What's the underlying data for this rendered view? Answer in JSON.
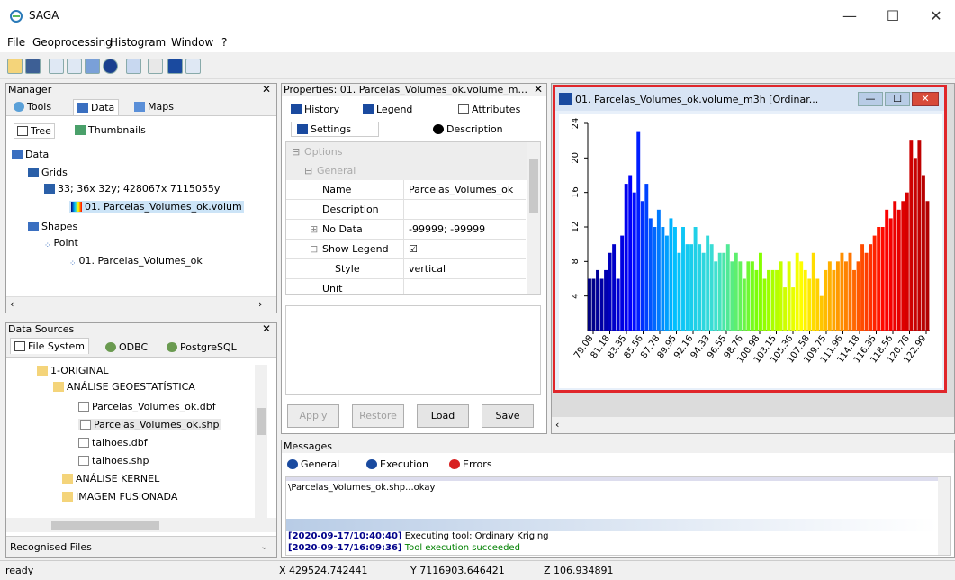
{
  "window": {
    "title": "SAGA",
    "minimize": "—",
    "maximize": "☐",
    "close": "✕"
  },
  "menu": [
    "File",
    "Geoprocessing",
    "Histogram",
    "Window",
    "?"
  ],
  "manager": {
    "title": "Manager",
    "tabs": [
      "Tools",
      "Data",
      "Maps"
    ],
    "subtabs": [
      "Tree",
      "Thumbnails"
    ],
    "tree": [
      "Data",
      "Grids",
      "33; 36x 32y; 428067x 7115055y",
      "01. Parcelas_Volumes_ok.volum",
      "Shapes",
      "Point",
      "01. Parcelas_Volumes_ok"
    ]
  },
  "datasources": {
    "title": "Data Sources",
    "tabs": [
      "File System",
      "ODBC",
      "PostgreSQL"
    ],
    "tree": [
      "1-ORIGINAL",
      "ANÁLISE GEOESTATÍSTICA",
      "Parcelas_Volumes_ok.dbf",
      "Parcelas_Volumes_ok.shp",
      "talhoes.dbf",
      "talhoes.shp",
      "ANÁLISE KERNEL",
      "IMAGEM FUSIONADA"
    ],
    "filter": "Recognised Files"
  },
  "properties": {
    "title": "Properties: 01. Parcelas_Volumes_ok.volume_m...",
    "tabs": [
      "History",
      "Legend",
      "Attributes",
      "Settings",
      "Description"
    ],
    "options_label": "Options",
    "general_label": "General",
    "rows": [
      {
        "key": "Name",
        "value": "Parcelas_Volumes_ok"
      },
      {
        "key": "Description",
        "value": ""
      },
      {
        "key": "No Data",
        "value": "-99999; -99999"
      },
      {
        "key": "Show Legend",
        "value": "☑"
      },
      {
        "key": "Style",
        "value": "vertical"
      },
      {
        "key": "Unit",
        "value": ""
      }
    ],
    "buttons": {
      "apply": "Apply",
      "restore": "Restore",
      "load": "Load",
      "save": "Save"
    }
  },
  "histogram_window": {
    "title": "01. Parcelas_Volumes_ok.volume_m3h [Ordinar...",
    "minimize": "—",
    "maximize": "☐",
    "close": "✕"
  },
  "chart_data": {
    "type": "bar",
    "ylim": [
      0,
      24
    ],
    "yticks": [
      "24",
      "20",
      "16",
      "12",
      "8",
      "4"
    ],
    "xticks": [
      "79.08",
      "81.18",
      "83.35",
      "85.56",
      "87.78",
      "89.95",
      "92.16",
      "94.33",
      "96.55",
      "98.76",
      "100.98",
      "103.15",
      "105.36",
      "107.58",
      "109.75",
      "111.96",
      "114.18",
      "116.35",
      "118.56",
      "120.78",
      "122.99"
    ],
    "values": [
      6,
      6,
      7,
      6,
      7,
      9,
      10,
      6,
      11,
      17,
      18,
      16,
      23,
      15,
      17,
      13,
      12,
      14,
      12,
      11,
      13,
      12,
      9,
      12,
      10,
      10,
      12,
      10,
      9,
      11,
      10,
      8,
      9,
      9,
      10,
      8,
      9,
      8,
      6,
      8,
      8,
      7,
      9,
      6,
      7,
      7,
      7,
      8,
      5,
      8,
      5,
      9,
      8,
      7,
      6,
      9,
      6,
      4,
      7,
      8,
      7,
      8,
      9,
      8,
      9,
      7,
      8,
      10,
      9,
      10,
      11,
      12,
      12,
      14,
      13,
      15,
      14,
      15,
      16,
      22,
      20,
      22,
      18,
      15
    ],
    "gradient": [
      "#00007f",
      "#0000ff",
      "#00bfff",
      "#40e0d0",
      "#7fff00",
      "#ffff00",
      "#ff8c00",
      "#ff0000",
      "#b00000"
    ]
  },
  "messages": {
    "title": "Messages",
    "tabs": [
      "General",
      "Execution",
      "Errors"
    ],
    "lines": [
      {
        "ts": "",
        "text": "\\Parcelas_Volumes_ok.shp...okay"
      },
      {
        "ts": "[2020-09-17/10:40:40]",
        "text": "Executing tool: Ordinary Kriging"
      },
      {
        "ts": "[2020-09-17/16:09:36]",
        "text": "Tool execution succeeded"
      }
    ]
  },
  "status": {
    "ready": "ready",
    "x": "X 429524.742441",
    "y": "Y 7116903.646421",
    "z": "Z 106.934891"
  },
  "colors": {
    "accent_red": "#e0262b",
    "selection": "#cce4f7"
  }
}
